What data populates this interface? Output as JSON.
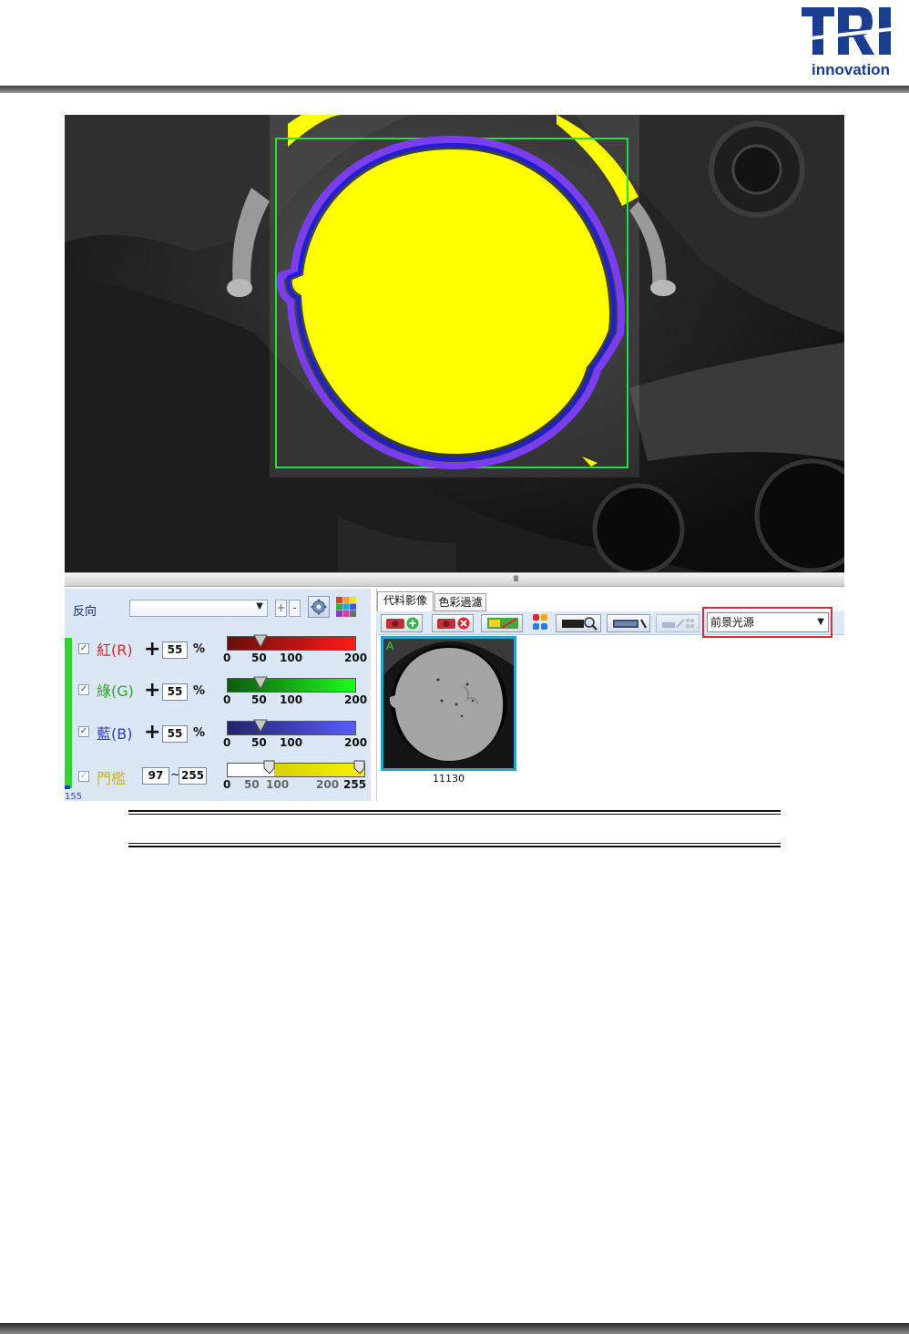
{
  "logo": {
    "wordmark": "TRI",
    "tagline": "innovation",
    "color": "#1b3d8f"
  },
  "controls": {
    "direction_label": "反向",
    "direction_value": "",
    "plus_button": "+",
    "minus_button": "-",
    "channels": [
      {
        "label": "紅(R)",
        "checked": true,
        "value": "55",
        "unit": "%",
        "color": "#d12a2a",
        "ticks": [
          "0",
          "50",
          "100",
          "200"
        ]
      },
      {
        "label": "綠(G)",
        "checked": true,
        "value": "55",
        "unit": "%",
        "color": "#2aa32a",
        "ticks": [
          "0",
          "50",
          "100",
          "200"
        ]
      },
      {
        "label": "藍(B)",
        "checked": true,
        "value": "55",
        "unit": "%",
        "color": "#2a3fb8",
        "ticks": [
          "0",
          "50",
          "100",
          "200"
        ]
      }
    ],
    "threshold": {
      "label": "門檻",
      "checked": true,
      "min": "97",
      "separator": "~",
      "max": "255",
      "ticks": [
        "0",
        "50",
        "100",
        "200",
        "255"
      ]
    },
    "left_snippet": "155"
  },
  "right_panel": {
    "tabs": [
      {
        "label": "代料影像",
        "active": true
      },
      {
        "label": "色彩過濾",
        "active": false
      }
    ],
    "light_source": "前景光源",
    "thumbnail": {
      "marker": "A",
      "caption": "11130"
    }
  },
  "splitter_grip": "III",
  "icons": [
    "capture-add-icon",
    "capture-remove-icon",
    "swap-image-icon",
    "color-dots-icon",
    "zoom-icon",
    "measure-icon",
    "layout-icon",
    "gear-icon",
    "color-grid-icon",
    "dropdown-arrow-icon"
  ]
}
